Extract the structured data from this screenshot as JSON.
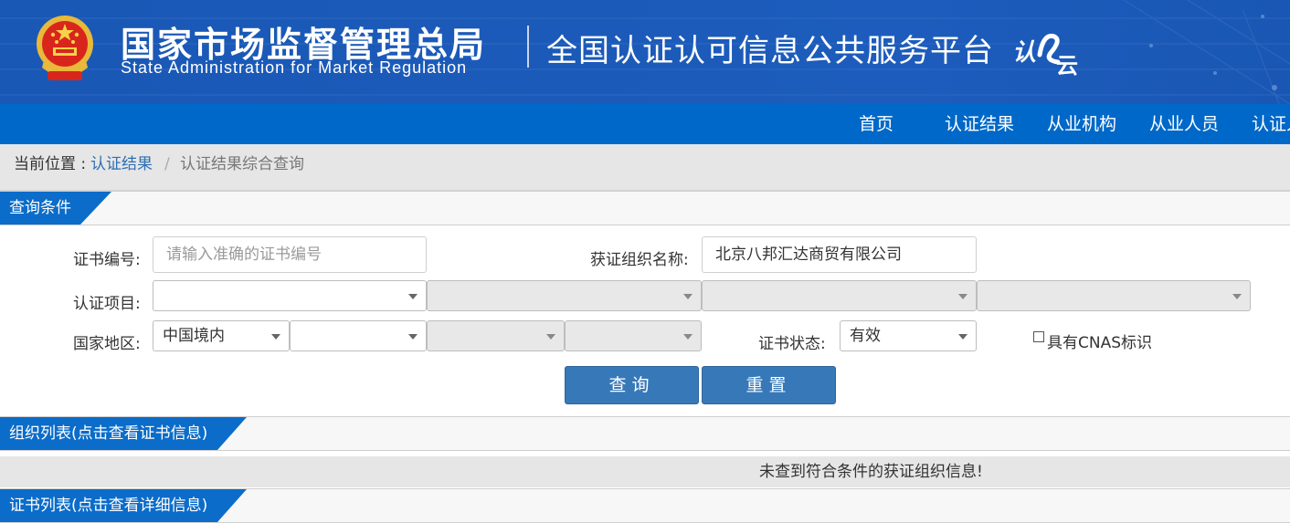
{
  "header": {
    "org_name_cn": "国家市场监督管理总局",
    "org_name_en": "State Administration  for  Market Regulation",
    "platform_title": "全国认证认可信息公共服务平台",
    "logo_text": "认证云",
    "emblem": "national-emblem-icon"
  },
  "nav": {
    "items": [
      "首页",
      "认证结果",
      "从业机构",
      "从业人员",
      "认证人"
    ]
  },
  "breadcrumb": {
    "prefix": "当前位置 :",
    "link": "认证结果",
    "separator": "/",
    "current": "认证结果综合查询"
  },
  "query_section": {
    "title": "查询条件",
    "cert_number": {
      "label": "证书编号:",
      "value": "",
      "placeholder": "请输入准确的证书编号"
    },
    "org_name": {
      "label": "获证组织名称:",
      "value": "北京八邦汇达商贸有限公司"
    },
    "cert_project": {
      "label": "认证项目:",
      "selects": [
        "",
        "",
        "",
        ""
      ]
    },
    "region": {
      "label": "国家地区:",
      "selects": [
        "中国境内",
        "",
        "",
        ""
      ]
    },
    "cert_status": {
      "label": "证书状态:",
      "value": "有效"
    },
    "cnas": {
      "label": "具有CNAS标识",
      "checked": false
    },
    "query_button": "查询",
    "reset_button": "重置"
  },
  "org_list": {
    "title": "组织列表(点击查看证书信息)",
    "empty_message": "未查到符合条件的获证组织信息!"
  },
  "cert_list": {
    "title": "证书列表(点击查看详细信息)"
  },
  "colors": {
    "header_bg": "#1b5ab8",
    "nav_bg": "#0068c8",
    "tab_bg": "#0b6cc9",
    "button_bg": "#3779b8",
    "link": "#2f6fb4"
  }
}
